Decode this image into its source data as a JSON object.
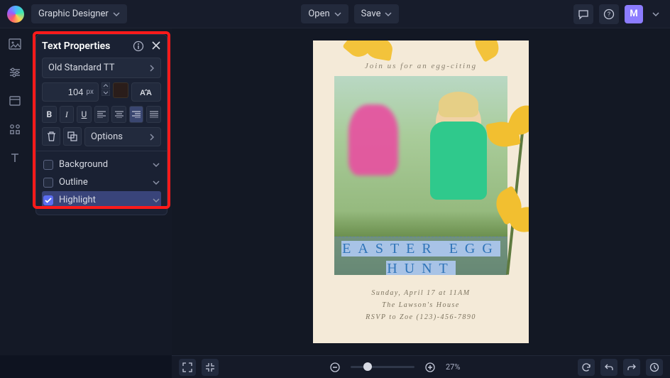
{
  "header": {
    "mode": "Graphic Designer",
    "open": "Open",
    "save": "Save",
    "avatar": "M"
  },
  "panel": {
    "title": "Text Properties",
    "font": "Old Standard TT",
    "size": "104",
    "unit": "px",
    "options": "Options",
    "background": "Background",
    "outline": "Outline",
    "highlight": "Highlight"
  },
  "poster": {
    "tagline": "Join us for an egg-citing",
    "title_line1": "EASTER EGG",
    "title_line2": "HUNT",
    "sub1": "Sunday, April 17 at 11AM",
    "sub2": "The Lawson's House",
    "sub3": "RSVP to Zoe (123)-456-7890"
  },
  "zoom": {
    "pct": "27%"
  }
}
